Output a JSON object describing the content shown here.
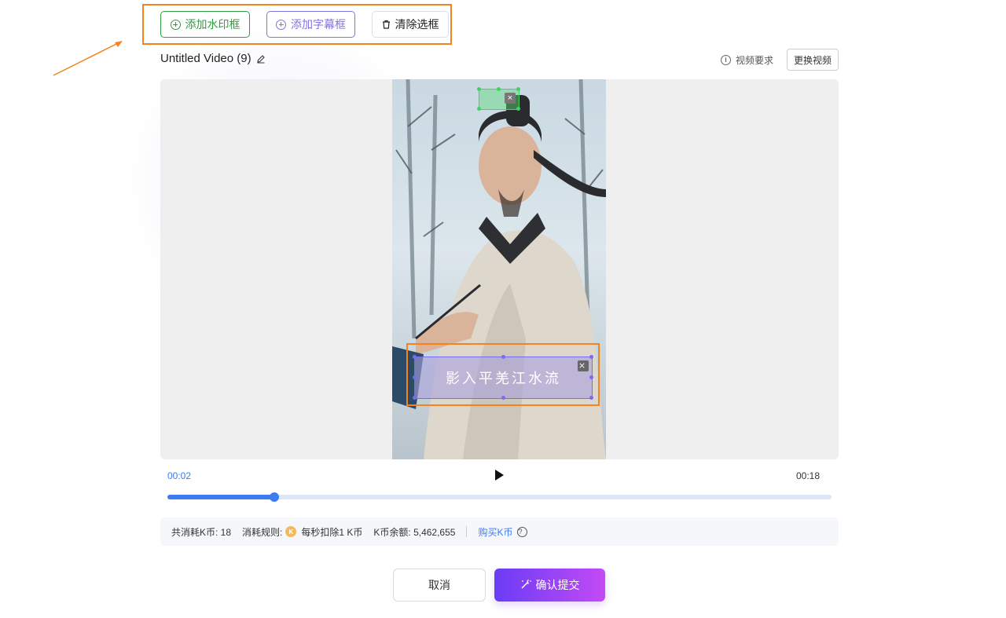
{
  "toolbar": {
    "add_watermark_label": "添加水印框",
    "add_subtitle_label": "添加字幕框",
    "clear_selection_label": "清除选框"
  },
  "header": {
    "title": "Untitled Video (9)",
    "requirements_label": "视频要求",
    "replace_video_label": "更换视频"
  },
  "video": {
    "subtitle_text": "影入平羌江水流",
    "close_glyph": "×"
  },
  "player": {
    "current_time": "00:02",
    "total_time": "00:18",
    "progress": 0.161
  },
  "billing": {
    "total_cost": "共消耗K币: 18",
    "rule_label": "消耗规则:",
    "rule_value": "每秒扣除1 K币",
    "balance": "K币余额: 5,462,655",
    "buy_label": "购买K币"
  },
  "actions": {
    "cancel_label": "取消",
    "submit_label": "确认提交"
  },
  "colors": {
    "accent_blue": "#3d7bf0",
    "highlight_orange": "#f58220",
    "watermark_green": "#2e9e3e",
    "subtitle_purple": "#7f74e0"
  }
}
